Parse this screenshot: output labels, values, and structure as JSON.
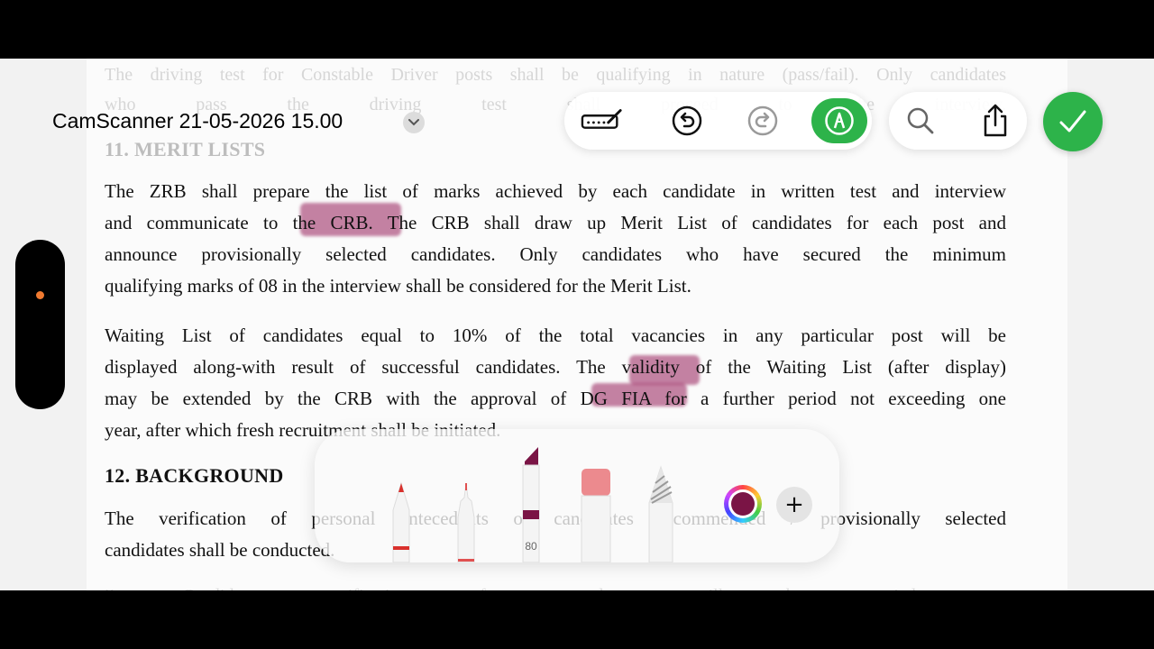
{
  "app": {
    "document_title": "CamScanner 21-05-2026 15.00",
    "accent_color": "#2db34a",
    "selected_ink_color": "#7a1445"
  },
  "toolbar": {
    "icons": [
      "markup-pen-icon",
      "undo-icon",
      "redo-icon",
      "markup-icon",
      "search-icon",
      "share-icon",
      "checkmark-icon"
    ]
  },
  "document": {
    "faded_top_lines": [
      "The driving test for Constable Driver posts shall be qualifying in nature (pass/fail). Only candidates",
      "who pass the driving test shall proceed to the interview."
    ],
    "section11_heading": "11. MERIT LISTS",
    "para1": [
      "The ZRB shall prepare the list of marks achieved by each candidate in written test and interview",
      "and communicate to the CRB. The CRB shall draw up Merit List of candidates for each post and",
      "announce provisionally selected candidates. Only candidates who have secured the minimum",
      "qualifying marks of 08 in the interview shall be considered for the Merit List."
    ],
    "para2": [
      "Waiting List of candidates equal to 10% of the total vacancies in any particular post will be",
      "displayed along-with result of successful candidates. The validity of the Waiting List (after display)",
      "may be extended by the CRB with the approval of DG FIA for a further period not exceeding one",
      "year, after which fresh recruitment shall be initiated."
    ],
    "section12_heading": "12. BACKGROUND",
    "para3": [
      "The verification of personal antecedents of candidates recommended / provisionally selected",
      "candidates shall be conducted."
    ],
    "bottom_faded": "ii.      Candidates verification of antecedents will be carried out."
  },
  "palette": {
    "tools": [
      {
        "name": "pen",
        "color": "#d9302c"
      },
      {
        "name": "fineliner",
        "color": "#e05050"
      },
      {
        "name": "marker",
        "color": "#7a1445",
        "opacity_label": "80"
      },
      {
        "name": "eraser",
        "color": "#ec8a8e"
      },
      {
        "name": "pencil",
        "color": "#9a9a9a"
      }
    ]
  }
}
